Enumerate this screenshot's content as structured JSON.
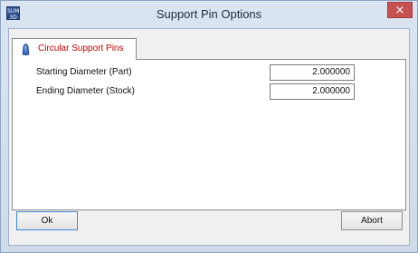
{
  "window": {
    "title": "Support Pin Options",
    "app_icon_text": "SUM 3D",
    "close_glyph": "×"
  },
  "tab": {
    "label": "Circular Support Pins",
    "icon": "support-pin-icon",
    "label_color": "#c20000"
  },
  "fields": [
    {
      "label": "Starting Diameter (Part)",
      "value": "2.000000"
    },
    {
      "label": "Ending Diameter (Stock)",
      "value": "2.000000"
    }
  ],
  "buttons": {
    "ok_label": "Ok",
    "abort_label": "Abort"
  },
  "colors": {
    "close_button": "#c75050",
    "title_bar": "#d6e1ee"
  }
}
